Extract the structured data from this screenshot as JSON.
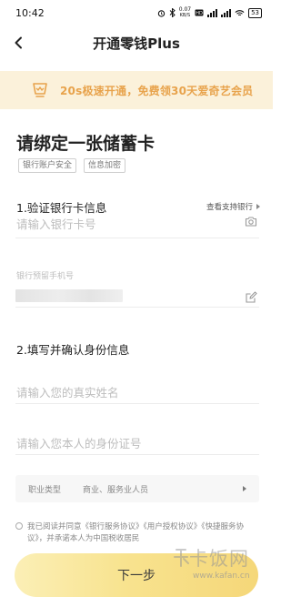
{
  "status_bar": {
    "time": "10:42",
    "speed_value": "0.07",
    "speed_unit": "KB/S",
    "battery": "53"
  },
  "nav": {
    "title": "开通零钱Plus"
  },
  "promo": {
    "text": "20s极速开通，免费领30天爱奇艺会员",
    "accent_color": "#e8a34c",
    "background_color": "#fbf1da"
  },
  "card": {
    "title": "请绑定一张储蓄卡",
    "tags": [
      "银行账户安全",
      "信息加密"
    ]
  },
  "section_verify": {
    "title": "1.验证银行卡信息",
    "support_link": "查看支持银行",
    "card_number_placeholder": "请输入银行卡号",
    "phone_label": "银行预留手机号"
  },
  "section_identity": {
    "title": "2.填写并确认身份信息",
    "name_placeholder": "请输入您的真实姓名",
    "id_placeholder": "请输入您本人的身份证号",
    "job_label": "职业类型",
    "job_value": "商业、服务业人员"
  },
  "agreement": {
    "text": "我已阅读并同意《银行服务协议》《用户授权协议》《快捷服务协议》，并承诺本人为中国税收居民"
  },
  "next_button": {
    "label": "下一步",
    "color": "#f8e38f"
  },
  "watermark": {
    "cn": "卡饭网",
    "en": "www.kafan.cn"
  }
}
